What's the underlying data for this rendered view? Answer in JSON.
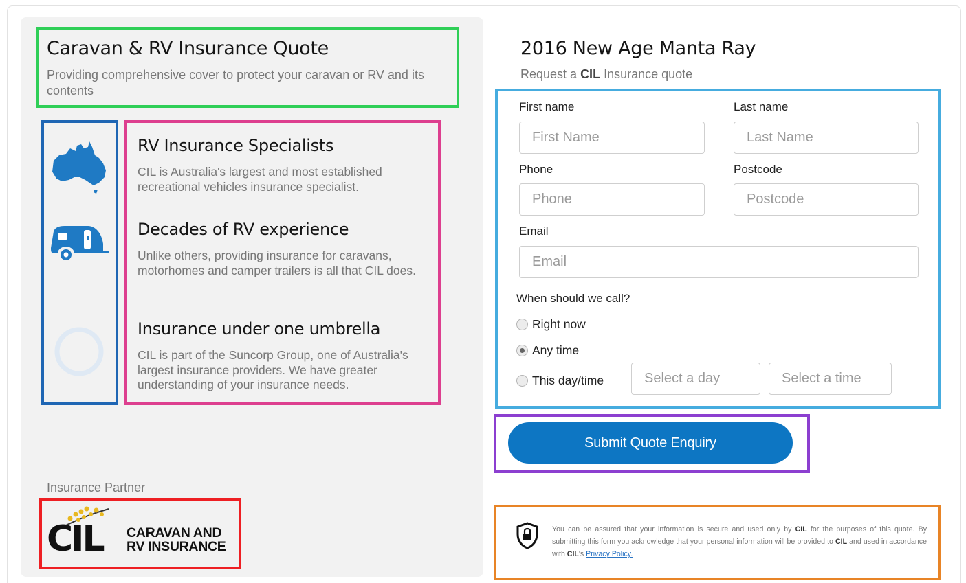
{
  "left": {
    "title": "Caravan & RV Insurance Quote",
    "subtitle": "Providing comprehensive cover to protect your caravan or RV and its contents",
    "features": [
      {
        "title": "RV Insurance Specialists",
        "text": "CIL is Australia's largest and most established recreational vehicles insurance specialist.",
        "icon": "australia-map-icon"
      },
      {
        "title": "Decades of RV experience",
        "text": "Unlike others, providing insurance for caravans, motorhomes and camper trailers is all that CIL does.",
        "icon": "caravan-icon"
      },
      {
        "title": "Insurance under one umbrella",
        "text": "CIL is part of the Suncorp Group, one of Australia's largest insurance providers. We have greater understanding of your insurance needs.",
        "icon": "loading-circle-icon"
      }
    ],
    "partner_label": "Insurance Partner",
    "logo": {
      "brand": "CIL",
      "line1": "CARAVAN AND",
      "line2": "RV INSURANCE"
    }
  },
  "form": {
    "title": "2016 New Age Manta Ray",
    "subtitle_prefix": "Request a ",
    "subtitle_brand": "CIL",
    "subtitle_suffix": " Insurance quote",
    "first_name_label": "First name",
    "first_name_placeholder": "First Name",
    "last_name_label": "Last name",
    "last_name_placeholder": "Last Name",
    "phone_label": "Phone",
    "phone_placeholder": "Phone",
    "postcode_label": "Postcode",
    "postcode_placeholder": "Postcode",
    "email_label": "Email",
    "email_placeholder": "Email",
    "call_label": "When should we call?",
    "call_options": [
      "Right now",
      "Any time",
      "This day/time"
    ],
    "call_selected": "Any time",
    "day_placeholder": "Select a day",
    "time_placeholder": "Select a time",
    "submit_label": "Submit Quote Enquiry"
  },
  "security": {
    "icon": "lock-shield-icon",
    "text_1": "You can be assured that your information is secure and used only by ",
    "brand": "CIL",
    "text_2": " for the purposes of this quote. By submitting this form you acknowledge that your personal information will be provided to ",
    "text_3": " and used in accordance with ",
    "brand_possessive": "CIL",
    "text_4": "'s ",
    "link": "Privacy Policy."
  },
  "colors": {
    "accent": "#0d76c3",
    "icon_blue": "#1f7ac4",
    "highlight_green": "#2fcf57",
    "highlight_blue": "#1f66b4",
    "highlight_pink": "#dd3f8f",
    "highlight_red": "#ee1f23",
    "highlight_sky": "#46acdf",
    "highlight_purple": "#8c3fd0",
    "highlight_orange": "#e88426"
  }
}
